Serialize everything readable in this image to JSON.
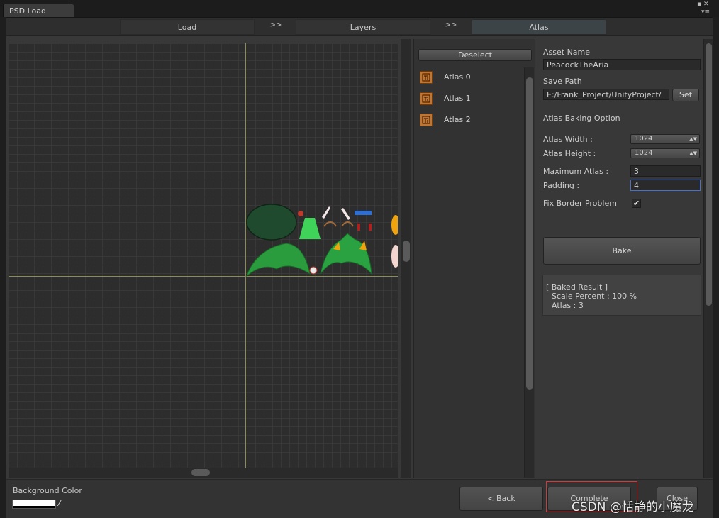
{
  "window": {
    "tab_title": "PSD Load"
  },
  "steps": {
    "load": "Load",
    "arrow1": ">>",
    "layers": "Layers",
    "arrow2": ">>",
    "atlas": "Atlas"
  },
  "atlas_list": {
    "deselect_label": "Deselect",
    "items": [
      {
        "label": "Atlas 0"
      },
      {
        "label": "Atlas 1"
      },
      {
        "label": "Atlas 2"
      }
    ]
  },
  "settings": {
    "asset_name_label": "Asset Name",
    "asset_name_value": "PeacockTheAria",
    "save_path_label": "Save Path",
    "save_path_value": "E:/Frank_Project/UnityProject/",
    "set_label": "Set",
    "baking_option_label": "Atlas Baking Option",
    "atlas_width_label": "Atlas Width :",
    "atlas_width_value": "1024",
    "atlas_height_label": "Atlas Height :",
    "atlas_height_value": "1024",
    "max_atlas_label": "Maximum Atlas :",
    "max_atlas_value": "3",
    "padding_label": "Padding :",
    "padding_value": "4",
    "fix_border_label": "Fix Border Problem",
    "fix_border_checked": true,
    "bake_label": "Bake",
    "result_title": "[ Baked Result ]",
    "result_scale": "Scale Percent : 100 %",
    "result_atlas": "Atlas : 3"
  },
  "footer": {
    "background_color_label": "Background Color",
    "back_label": "< Back",
    "complete_label": "Complete",
    "close_label": "Close"
  },
  "watermark": "CSDN @恬静的小魔龙",
  "colors": {
    "axis": "#8c8c55",
    "highlight": "#d23a3a",
    "focus": "#4a70c8",
    "atlas_icon": "#c4742b"
  }
}
